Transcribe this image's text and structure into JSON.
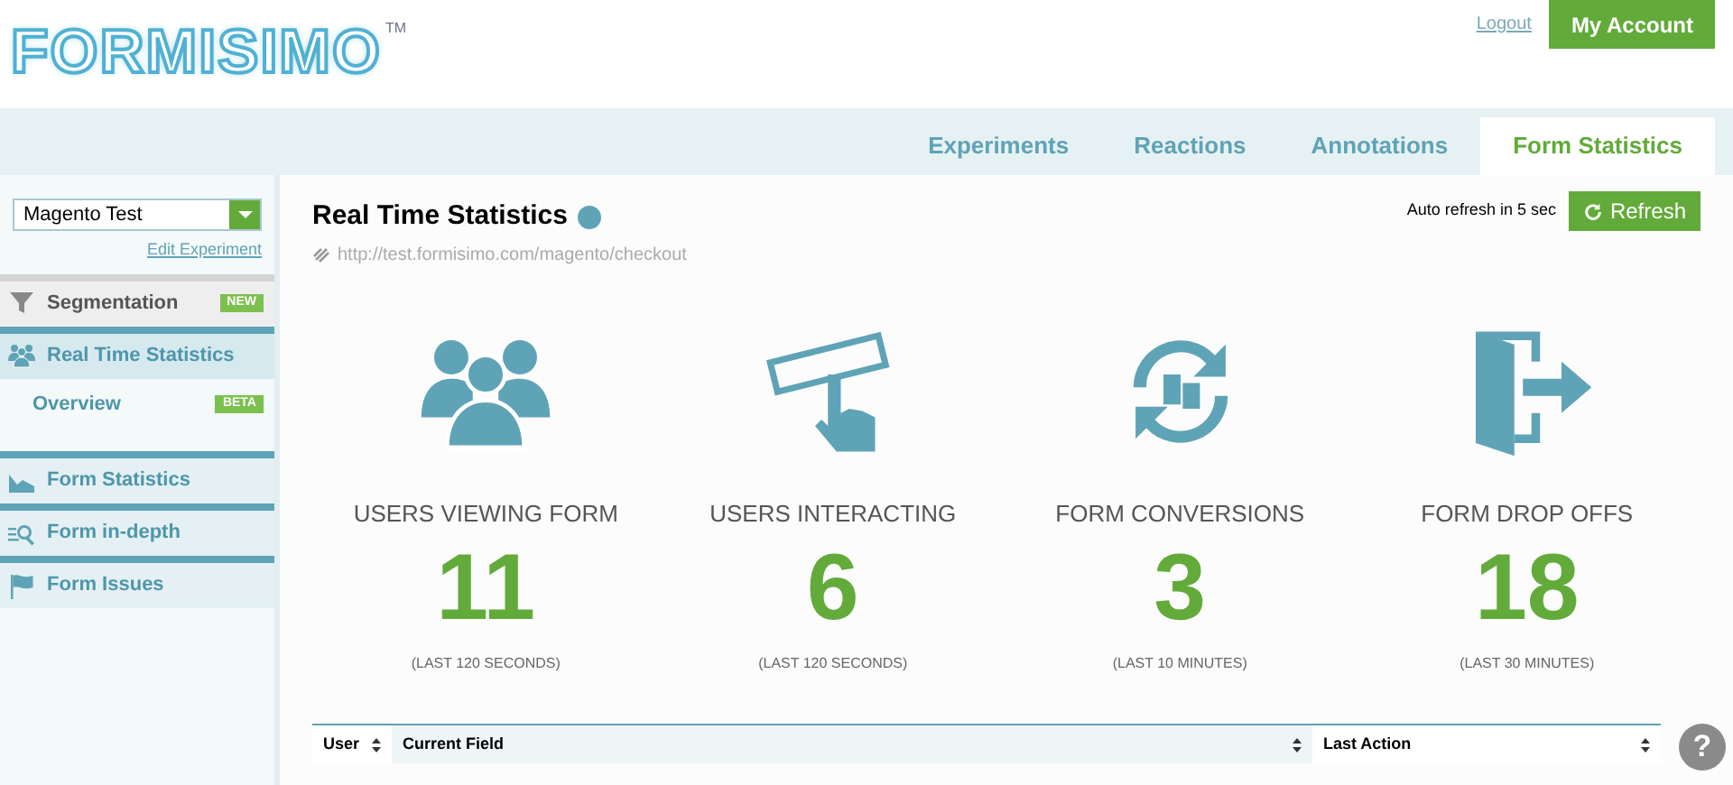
{
  "logo": {
    "text": "FORMISIMO",
    "trademark": "TM"
  },
  "header": {
    "logout": "Logout",
    "account_button": "My Account"
  },
  "tabs": [
    {
      "label": "Experiments",
      "selected": false
    },
    {
      "label": "Reactions",
      "selected": false
    },
    {
      "label": "Annotations",
      "selected": false
    },
    {
      "label": "Form Statistics",
      "selected": true
    }
  ],
  "sidebar": {
    "experiment_select": "Magento Test",
    "edit_link": "Edit Experiment",
    "items": [
      {
        "kind": "segmentation",
        "label": "Segmentation",
        "badge": "NEW",
        "selected": false
      },
      {
        "kind": "section",
        "label": "Real Time Statistics",
        "selected": true,
        "children": [
          {
            "label": "Overview",
            "badge": "BETA"
          }
        ]
      },
      {
        "kind": "section",
        "label": "Form Statistics",
        "selected": false
      },
      {
        "kind": "section",
        "label": "Form in-depth",
        "selected": false
      },
      {
        "kind": "section",
        "label": "Form Issues",
        "selected": false
      }
    ]
  },
  "main": {
    "title": "Real Time Statistics",
    "url": "http://test.formisimo.com/magento/checkout",
    "auto_refresh": "Auto refresh in 5 sec",
    "refresh_button": "Refresh",
    "stats": [
      {
        "label": "USERS VIEWING FORM",
        "value": "11",
        "period": "(LAST 120 SECONDS)"
      },
      {
        "label": "USERS INTERACTING",
        "value": "6",
        "period": "(LAST 120 SECONDS)"
      },
      {
        "label": "FORM CONVERSIONS",
        "value": "3",
        "period": "(LAST 10 MINUTES)"
      },
      {
        "label": "FORM DROP OFFS",
        "value": "18",
        "period": "(LAST 30 MINUTES)"
      }
    ],
    "table": {
      "columns": [
        "User",
        "Current Field",
        "Last Action"
      ]
    }
  },
  "help_button": "?"
}
